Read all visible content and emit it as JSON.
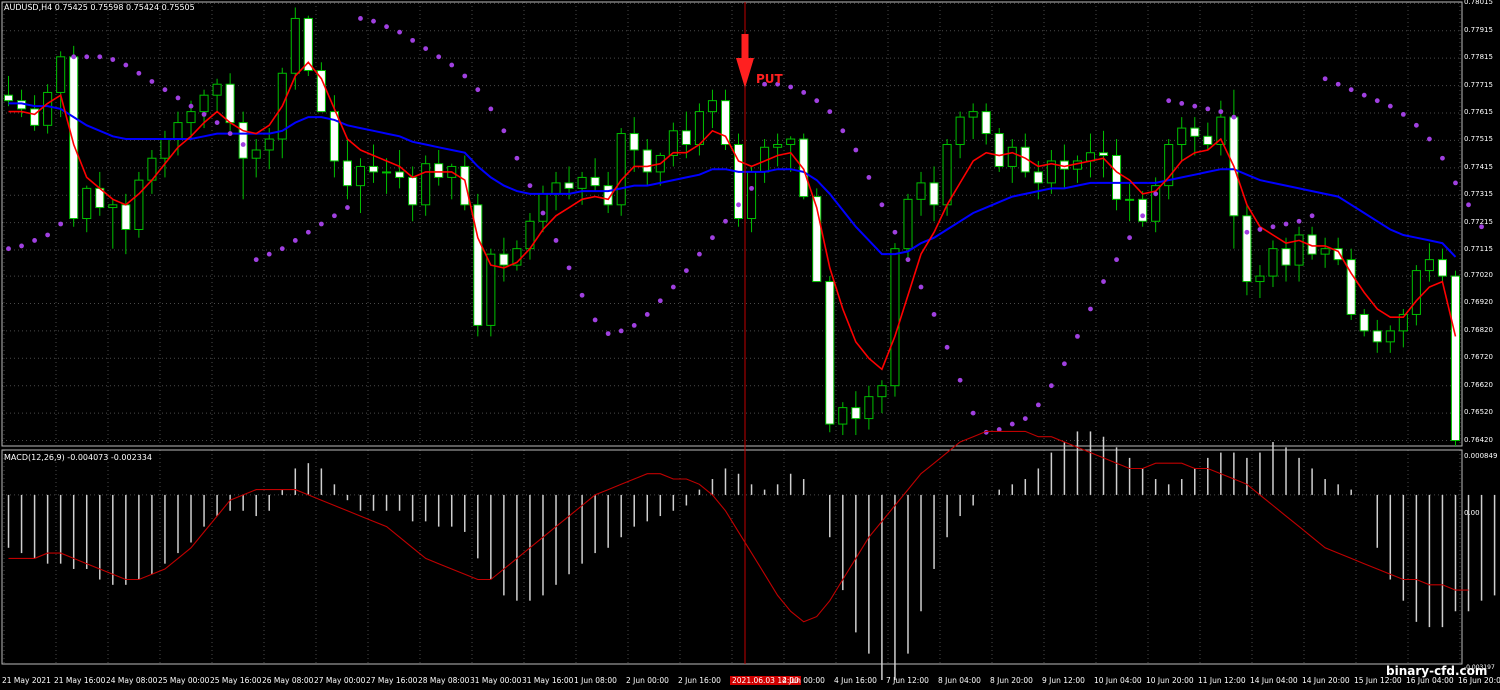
{
  "header": {
    "title": "AUDUSD,H4",
    "ohlc": "0.75425 0.75598 0.75424 0.75505",
    "macd_label": "MACD(12,26,9) -0.004073 -0.002334"
  },
  "annotation": {
    "signal": "PUT"
  },
  "watermark": "binary-cfd.com",
  "colors": {
    "bull_candle": "#00c000",
    "bear_candle": "#ffffff",
    "background": "#000000",
    "ma_fast": "#ff0000",
    "ma_slow": "#0000ff",
    "sar": "#a040e0",
    "grid": "#4a4a4a",
    "marker": "#ff2020"
  },
  "price_axis": {
    "labels": [
      "0.78015",
      "0.77915",
      "0.77815",
      "0.77715",
      "0.77615",
      "0.77515",
      "0.77415",
      "0.77315",
      "0.77215",
      "0.77115",
      "0.77020",
      "0.76920",
      "0.76820",
      "0.76720",
      "0.76620",
      "0.76520",
      "0.76420"
    ]
  },
  "macd_axis": {
    "top": "0.000849",
    "zero": "0.00",
    "bottom": "-0.003197"
  },
  "time_axis": {
    "labels": [
      "21 May 2021",
      "21 May 16:00",
      "24 May 08:00",
      "25 May 00:00",
      "25 May 16:00",
      "26 May 08:00",
      "27 May 00:00",
      "27 May 16:00",
      "28 May 08:00",
      "31 May 00:00",
      "31 May 16:00",
      "1 Jun 08:00",
      "2 Jun 00:00",
      "2 Jun 16:00",
      "2021.06.03 12:00",
      "4 Jun 00:00",
      "4 Jun 16:00",
      "7 Jun 12:00",
      "8 Jun 04:00",
      "8 Jun 20:00",
      "9 Jun 12:00",
      "10 Jun 04:00",
      "10 Jun 20:00",
      "11 Jun 12:00",
      "14 Jun 04:00",
      "14 Jun 20:00",
      "15 Jun 12:00",
      "16 Jun 04:00",
      "16 Jun 20:00"
    ],
    "highlight": "2021.06.03 12:00"
  },
  "chart_data": {
    "type": "candlestick",
    "symbol": "AUDUSD",
    "timeframe": "H4",
    "ylim": [
      0.764,
      0.7802
    ],
    "macd_ylim": [
      -0.003197,
      0.000849
    ],
    "candles": [
      [
        0.7768,
        0.7775,
        0.7764,
        0.7766
      ],
      [
        0.7766,
        0.777,
        0.776,
        0.7763
      ],
      [
        0.7763,
        0.7768,
        0.7755,
        0.7757
      ],
      [
        0.7757,
        0.7772,
        0.7754,
        0.7769
      ],
      [
        0.7769,
        0.7784,
        0.776,
        0.7782
      ],
      [
        0.7782,
        0.7786,
        0.772,
        0.7723
      ],
      [
        0.7723,
        0.7735,
        0.7718,
        0.7734
      ],
      [
        0.7734,
        0.774,
        0.7724,
        0.7727
      ],
      [
        0.7727,
        0.773,
        0.7712,
        0.7728
      ],
      [
        0.7728,
        0.7732,
        0.771,
        0.7719
      ],
      [
        0.7719,
        0.774,
        0.7716,
        0.7737
      ],
      [
        0.7737,
        0.7748,
        0.7732,
        0.7745
      ],
      [
        0.7745,
        0.7755,
        0.7738,
        0.7752
      ],
      [
        0.7752,
        0.7762,
        0.7746,
        0.7758
      ],
      [
        0.7758,
        0.7766,
        0.7752,
        0.7762
      ],
      [
        0.7762,
        0.777,
        0.7756,
        0.7768
      ],
      [
        0.7768,
        0.7774,
        0.7762,
        0.7772
      ],
      [
        0.7772,
        0.7776,
        0.7755,
        0.7758
      ],
      [
        0.7758,
        0.7762,
        0.773,
        0.7745
      ],
      [
        0.7745,
        0.7752,
        0.7738,
        0.7748
      ],
      [
        0.7748,
        0.7756,
        0.7741,
        0.7752
      ],
      [
        0.7752,
        0.7778,
        0.7745,
        0.7776
      ],
      [
        0.7776,
        0.78,
        0.777,
        0.7796
      ],
      [
        0.7796,
        0.7797,
        0.7775,
        0.7777
      ],
      [
        0.7777,
        0.778,
        0.7762,
        0.7762
      ],
      [
        0.7762,
        0.7768,
        0.7738,
        0.7744
      ],
      [
        0.7744,
        0.7752,
        0.773,
        0.7735
      ],
      [
        0.7735,
        0.7745,
        0.7725,
        0.7742
      ],
      [
        0.7742,
        0.775,
        0.7736,
        0.774
      ],
      [
        0.774,
        0.7745,
        0.7732,
        0.774
      ],
      [
        0.774,
        0.7748,
        0.7734,
        0.7738
      ],
      [
        0.7738,
        0.7742,
        0.7722,
        0.7728
      ],
      [
        0.7728,
        0.7746,
        0.7724,
        0.7743
      ],
      [
        0.7743,
        0.7748,
        0.7735,
        0.7738
      ],
      [
        0.7738,
        0.7743,
        0.773,
        0.7742
      ],
      [
        0.7742,
        0.7746,
        0.7726,
        0.7728
      ],
      [
        0.7728,
        0.7732,
        0.768,
        0.7684
      ],
      [
        0.7684,
        0.7712,
        0.768,
        0.771
      ],
      [
        0.771,
        0.7716,
        0.77,
        0.7706
      ],
      [
        0.7706,
        0.7715,
        0.7704,
        0.7712
      ],
      [
        0.7712,
        0.7725,
        0.7708,
        0.7722
      ],
      [
        0.7722,
        0.7735,
        0.7718,
        0.7732
      ],
      [
        0.7732,
        0.774,
        0.7726,
        0.7736
      ],
      [
        0.7736,
        0.7742,
        0.773,
        0.7734
      ],
      [
        0.7734,
        0.774,
        0.7728,
        0.7738
      ],
      [
        0.7738,
        0.7745,
        0.7733,
        0.7735
      ],
      [
        0.7735,
        0.774,
        0.7725,
        0.7728
      ],
      [
        0.7728,
        0.7756,
        0.7724,
        0.7754
      ],
      [
        0.7754,
        0.776,
        0.774,
        0.7748
      ],
      [
        0.7748,
        0.7752,
        0.7735,
        0.774
      ],
      [
        0.774,
        0.7747,
        0.7735,
        0.7746
      ],
      [
        0.7746,
        0.7758,
        0.7742,
        0.7755
      ],
      [
        0.7755,
        0.7762,
        0.7745,
        0.775
      ],
      [
        0.775,
        0.7765,
        0.7746,
        0.7762
      ],
      [
        0.7762,
        0.777,
        0.7756,
        0.7766
      ],
      [
        0.7766,
        0.777,
        0.7748,
        0.775
      ],
      [
        0.775,
        0.7754,
        0.772,
        0.7723
      ],
      [
        0.7723,
        0.7742,
        0.7718,
        0.774
      ],
      [
        0.774,
        0.7752,
        0.7736,
        0.7749
      ],
      [
        0.7749,
        0.7754,
        0.7742,
        0.775
      ],
      [
        0.775,
        0.7753,
        0.774,
        0.7752
      ],
      [
        0.7752,
        0.7754,
        0.773,
        0.7731
      ],
      [
        0.7731,
        0.7734,
        0.77,
        0.77
      ],
      [
        0.77,
        0.7702,
        0.7645,
        0.7648
      ],
      [
        0.7648,
        0.7656,
        0.7644,
        0.7654
      ],
      [
        0.7654,
        0.766,
        0.7644,
        0.765
      ],
      [
        0.765,
        0.7662,
        0.7646,
        0.7658
      ],
      [
        0.7658,
        0.7664,
        0.7652,
        0.7662
      ],
      [
        0.7662,
        0.7714,
        0.7658,
        0.7712
      ],
      [
        0.7712,
        0.7732,
        0.7708,
        0.773
      ],
      [
        0.773,
        0.774,
        0.7724,
        0.7736
      ],
      [
        0.7736,
        0.7742,
        0.7722,
        0.7728
      ],
      [
        0.7728,
        0.7752,
        0.7724,
        0.775
      ],
      [
        0.775,
        0.7762,
        0.7745,
        0.776
      ],
      [
        0.776,
        0.7765,
        0.7752,
        0.7762
      ],
      [
        0.7762,
        0.7765,
        0.775,
        0.7754
      ],
      [
        0.7754,
        0.7756,
        0.774,
        0.7742
      ],
      [
        0.7742,
        0.7752,
        0.7736,
        0.7749
      ],
      [
        0.7749,
        0.7754,
        0.7738,
        0.774
      ],
      [
        0.774,
        0.7744,
        0.773,
        0.7736
      ],
      [
        0.7736,
        0.7748,
        0.7732,
        0.7744
      ],
      [
        0.7744,
        0.775,
        0.7734,
        0.7741
      ],
      [
        0.7741,
        0.7746,
        0.7736,
        0.7744
      ],
      [
        0.7744,
        0.7754,
        0.7738,
        0.7747
      ],
      [
        0.7747,
        0.7755,
        0.7738,
        0.7746
      ],
      [
        0.7746,
        0.7752,
        0.7726,
        0.773
      ],
      [
        0.773,
        0.7736,
        0.7722,
        0.773
      ],
      [
        0.773,
        0.7733,
        0.772,
        0.7722
      ],
      [
        0.7722,
        0.7738,
        0.7718,
        0.7735
      ],
      [
        0.7735,
        0.7752,
        0.773,
        0.775
      ],
      [
        0.775,
        0.776,
        0.7744,
        0.7756
      ],
      [
        0.7756,
        0.776,
        0.7746,
        0.7753
      ],
      [
        0.7753,
        0.7758,
        0.7748,
        0.775
      ],
      [
        0.775,
        0.7766,
        0.7746,
        0.776
      ],
      [
        0.776,
        0.777,
        0.7712,
        0.7724
      ],
      [
        0.7724,
        0.7728,
        0.7695,
        0.77
      ],
      [
        0.77,
        0.7706,
        0.7694,
        0.7702
      ],
      [
        0.7702,
        0.7715,
        0.7698,
        0.7712
      ],
      [
        0.7712,
        0.7716,
        0.77,
        0.7706
      ],
      [
        0.7706,
        0.772,
        0.77,
        0.7717
      ],
      [
        0.7717,
        0.772,
        0.7708,
        0.771
      ],
      [
        0.771,
        0.7716,
        0.7705,
        0.7712
      ],
      [
        0.7712,
        0.7716,
        0.7706,
        0.7708
      ],
      [
        0.7708,
        0.7712,
        0.7686,
        0.7688
      ],
      [
        0.7688,
        0.769,
        0.768,
        0.7682
      ],
      [
        0.7682,
        0.7686,
        0.7674,
        0.7678
      ],
      [
        0.7678,
        0.7684,
        0.7674,
        0.7682
      ],
      [
        0.7682,
        0.769,
        0.7676,
        0.7688
      ],
      [
        0.7688,
        0.7706,
        0.7684,
        0.7704
      ],
      [
        0.7704,
        0.7714,
        0.77,
        0.7708
      ],
      [
        0.7708,
        0.7712,
        0.77,
        0.7702
      ],
      [
        0.7702,
        0.7704,
        0.764,
        0.7642
      ]
    ],
    "ma_fast": [
      0.7762,
      0.7762,
      0.7761,
      0.7765,
      0.7768,
      0.775,
      0.7738,
      0.7734,
      0.773,
      0.7728,
      0.7732,
      0.7737,
      0.7743,
      0.7749,
      0.7753,
      0.7758,
      0.7762,
      0.7758,
      0.7755,
      0.7754,
      0.7757,
      0.7764,
      0.7775,
      0.778,
      0.7774,
      0.7763,
      0.7752,
      0.7748,
      0.7746,
      0.7744,
      0.7742,
      0.7738,
      0.774,
      0.774,
      0.774,
      0.7737,
      0.7716,
      0.7706,
      0.7705,
      0.7707,
      0.7712,
      0.7719,
      0.7724,
      0.7727,
      0.773,
      0.7731,
      0.773,
      0.7737,
      0.7742,
      0.7742,
      0.7743,
      0.7747,
      0.7747,
      0.775,
      0.7755,
      0.7753,
      0.7744,
      0.7742,
      0.7744,
      0.7746,
      0.7747,
      0.7741,
      0.7727,
      0.7705,
      0.769,
      0.7678,
      0.7672,
      0.7668,
      0.768,
      0.7695,
      0.771,
      0.7718,
      0.7728,
      0.7736,
      0.7744,
      0.7747,
      0.7746,
      0.7747,
      0.7745,
      0.7742,
      0.7743,
      0.7742,
      0.7743,
      0.7744,
      0.7745,
      0.774,
      0.7737,
      0.7732,
      0.7733,
      0.7738,
      0.7744,
      0.7747,
      0.7748,
      0.7752,
      0.7742,
      0.7728,
      0.772,
      0.7717,
      0.7714,
      0.7715,
      0.7713,
      0.7713,
      0.7711,
      0.7703,
      0.7696,
      0.769,
      0.7687,
      0.7687,
      0.7693,
      0.7698,
      0.77,
      0.768
    ],
    "ma_slow": [
      0.7765,
      0.7765,
      0.7764,
      0.7764,
      0.7763,
      0.776,
      0.7757,
      0.7755,
      0.7753,
      0.7752,
      0.7752,
      0.7752,
      0.7752,
      0.7752,
      0.7752,
      0.7753,
      0.7754,
      0.7754,
      0.7754,
      0.7754,
      0.7754,
      0.7755,
      0.7758,
      0.776,
      0.776,
      0.7759,
      0.7757,
      0.7756,
      0.7755,
      0.7754,
      0.7753,
      0.7751,
      0.775,
      0.7749,
      0.7748,
      0.7747,
      0.7742,
      0.7738,
      0.7735,
      0.7733,
      0.7732,
      0.7732,
      0.7732,
      0.7732,
      0.7733,
      0.7733,
      0.7733,
      0.7734,
      0.7735,
      0.7735,
      0.7736,
      0.7737,
      0.7738,
      0.7739,
      0.7741,
      0.7741,
      0.774,
      0.774,
      0.774,
      0.7741,
      0.7741,
      0.774,
      0.7737,
      0.7732,
      0.7726,
      0.772,
      0.7715,
      0.771,
      0.771,
      0.7711,
      0.7714,
      0.7716,
      0.7719,
      0.7722,
      0.7725,
      0.7727,
      0.7729,
      0.7731,
      0.7732,
      0.7733,
      0.7734,
      0.7734,
      0.7735,
      0.7736,
      0.7736,
      0.7736,
      0.7736,
      0.7736,
      0.7736,
      0.7737,
      0.7738,
      0.7739,
      0.774,
      0.7741,
      0.7741,
      0.7739,
      0.7737,
      0.7736,
      0.7735,
      0.7734,
      0.7733,
      0.7732,
      0.7731,
      0.7728,
      0.7725,
      0.7722,
      0.7719,
      0.7717,
      0.7716,
      0.7715,
      0.7714,
      0.7709
    ],
    "sar": [
      0.7712,
      0.7713,
      0.7715,
      0.7717,
      0.7721,
      0.7782,
      0.7782,
      0.7782,
      0.7781,
      0.7779,
      0.7776,
      0.7773,
      0.777,
      0.7767,
      0.7764,
      0.7761,
      0.7758,
      0.7754,
      0.775,
      0.7708,
      0.771,
      0.7712,
      0.7715,
      0.7718,
      0.7721,
      0.7724,
      0.7727,
      0.7796,
      0.7795,
      0.7793,
      0.7791,
      0.7788,
      0.7785,
      0.7782,
      0.7779,
      0.7775,
      0.777,
      0.7763,
      0.7755,
      0.7745,
      0.7735,
      0.7725,
      0.7715,
      0.7705,
      0.7695,
      0.7686,
      0.7681,
      0.7682,
      0.7684,
      0.7688,
      0.7693,
      0.7698,
      0.7704,
      0.771,
      0.7716,
      0.7722,
      0.7728,
      0.7734,
      0.7772,
      0.7772,
      0.7771,
      0.7769,
      0.7766,
      0.7762,
      0.7755,
      0.7748,
      0.7738,
      0.7728,
      0.7718,
      0.7708,
      0.7698,
      0.7688,
      0.7676,
      0.7664,
      0.7652,
      0.7645,
      0.7646,
      0.7648,
      0.765,
      0.7655,
      0.7662,
      0.767,
      0.768,
      0.769,
      0.77,
      0.7708,
      0.7716,
      0.7724,
      0.7732,
      0.7766,
      0.7765,
      0.7764,
      0.7763,
      0.7762,
      0.776,
      0.7718,
      0.7719,
      0.772,
      0.7721,
      0.7722,
      0.7724,
      0.7774,
      0.7772,
      0.777,
      0.7768,
      0.7766,
      0.7764,
      0.7761,
      0.7757,
      0.7752,
      0.7745,
      0.7736,
      0.7728,
      0.772
    ],
    "macd_hist": [
      -0.001,
      -0.0011,
      -0.0012,
      -0.0013,
      -0.0013,
      -0.0014,
      -0.0014,
      -0.0016,
      -0.0017,
      -0.0017,
      -0.0016,
      -0.0015,
      -0.0013,
      -0.0011,
      -0.0009,
      -0.0006,
      -0.0004,
      -0.0003,
      -0.0003,
      -0.0004,
      -0.0003,
      0.0001,
      0.0005,
      0.0006,
      0.0005,
      0.0002,
      -0.0001,
      -0.0003,
      -0.0003,
      -0.0003,
      -0.0003,
      -0.0005,
      -0.0005,
      -0.0006,
      -0.0006,
      -0.0007,
      -0.0012,
      -0.0016,
      -0.0019,
      -0.002,
      -0.002,
      -0.0019,
      -0.0017,
      -0.0015,
      -0.0013,
      -0.0011,
      -0.001,
      -0.0008,
      -0.0006,
      -0.0005,
      -0.0004,
      -0.0003,
      -0.0002,
      0.0001,
      0.0003,
      0.0005,
      0.0004,
      0.0002,
      0.0001,
      0.0002,
      0.0004,
      0.0003,
      0.0,
      -0.0008,
      -0.0018,
      -0.0026,
      -0.003,
      -0.0035,
      -0.0035,
      -0.003,
      -0.0022,
      -0.0014,
      -0.0008,
      -0.0004,
      -0.0002,
      0.0,
      0.0001,
      0.0002,
      0.0003,
      0.0005,
      0.0008,
      0.001,
      0.0012,
      0.0012,
      0.0011,
      0.0009,
      0.0007,
      0.0005,
      0.0003,
      0.0002,
      0.0003,
      0.0005,
      0.0007,
      0.0008,
      0.0008,
      0.0007,
      0.0008,
      0.001,
      0.0009,
      0.0007,
      0.0005,
      0.0003,
      0.0002,
      0.0001,
      0.0,
      -0.001,
      -0.0016,
      -0.002,
      -0.0024,
      -0.0025,
      -0.0025,
      -0.0022,
      -0.0022,
      -0.002,
      -0.0019
    ],
    "macd_signal": [
      -0.0012,
      -0.0012,
      -0.0012,
      -0.0011,
      -0.0011,
      -0.0012,
      -0.0013,
      -0.0014,
      -0.0015,
      -0.0016,
      -0.0016,
      -0.0015,
      -0.0014,
      -0.0012,
      -0.001,
      -0.0007,
      -0.0004,
      -0.0001,
      0.0,
      0.0001,
      0.0001,
      0.0001,
      0.0001,
      0.0,
      -0.0001,
      -0.0002,
      -0.0003,
      -0.0004,
      -0.0005,
      -0.0006,
      -0.0008,
      -0.001,
      -0.0012,
      -0.0013,
      -0.0014,
      -0.0015,
      -0.0016,
      -0.0016,
      -0.0014,
      -0.0012,
      -0.001,
      -0.0008,
      -0.0006,
      -0.0004,
      -0.0002,
      0.0,
      0.0001,
      0.0002,
      0.0003,
      0.0004,
      0.0004,
      0.0003,
      0.0003,
      0.0002,
      0.0,
      -0.0003,
      -0.0007,
      -0.0011,
      -0.0015,
      -0.0019,
      -0.0022,
      -0.0024,
      -0.0023,
      -0.002,
      -0.0016,
      -0.0012,
      -0.0008,
      -0.0005,
      -0.0002,
      0.0001,
      0.0004,
      0.0006,
      0.0008,
      0.001,
      0.0011,
      0.0012,
      0.0012,
      0.0012,
      0.0012,
      0.0011,
      0.0011,
      0.001,
      0.0009,
      0.0008,
      0.0007,
      0.0006,
      0.0005,
      0.0005,
      0.0006,
      0.0006,
      0.0006,
      0.0005,
      0.0005,
      0.0004,
      0.0003,
      0.0002,
      0.0,
      -0.0002,
      -0.0004,
      -0.0006,
      -0.0008,
      -0.001,
      -0.0011,
      -0.0012,
      -0.0013,
      -0.0014,
      -0.0015,
      -0.0016,
      -0.0016,
      -0.0017,
      -0.0017,
      -0.0018,
      -0.0018
    ]
  }
}
